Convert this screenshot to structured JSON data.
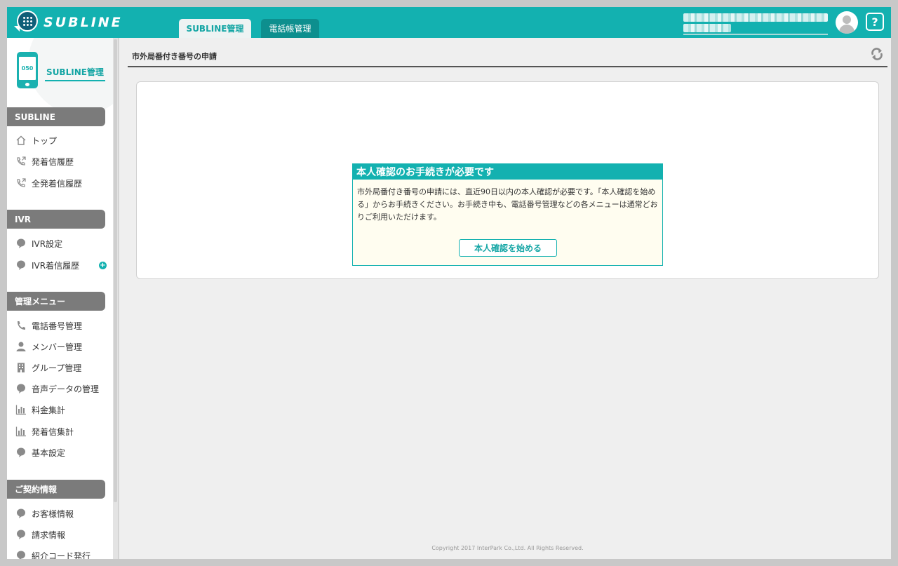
{
  "header": {
    "logo_text": "SUBLINE",
    "tabs": [
      {
        "label": "SUBLINE管理",
        "active": true
      },
      {
        "label": "電話帳管理",
        "active": false
      }
    ],
    "help_label": "?"
  },
  "sidebar": {
    "brand": {
      "phone_number_prefix": "050",
      "label": "SUBLINE管理"
    },
    "sections": [
      {
        "title": "SUBLINE",
        "items": [
          {
            "label": "トップ",
            "icon": "home-icon"
          },
          {
            "label": "発着信履歴",
            "icon": "phone-arrow-icon"
          },
          {
            "label": "全発着信履歴",
            "icon": "phone-arrow-icon"
          }
        ]
      },
      {
        "title": "IVR",
        "items": [
          {
            "label": "IVR設定",
            "icon": "bubble-icon"
          },
          {
            "label": "IVR着信履歴",
            "icon": "bubble-icon",
            "badge": "+"
          }
        ]
      },
      {
        "title": "管理メニュー",
        "items": [
          {
            "label": "電話番号管理",
            "icon": "phone-icon"
          },
          {
            "label": "メンバー管理",
            "icon": "person-icon"
          },
          {
            "label": "グループ管理",
            "icon": "building-icon"
          },
          {
            "label": "音声データの管理",
            "icon": "bubble-icon"
          },
          {
            "label": "料金集計",
            "icon": "bar-chart-icon"
          },
          {
            "label": "発着信集計",
            "icon": "bar-chart-icon"
          },
          {
            "label": "基本設定",
            "icon": "bubble-icon"
          }
        ]
      },
      {
        "title": "ご契約情報",
        "items": [
          {
            "label": "お客様情報",
            "icon": "bubble-icon"
          },
          {
            "label": "請求情報",
            "icon": "bubble-icon"
          },
          {
            "label": "紹介コード発行",
            "icon": "bubble-icon"
          }
        ]
      }
    ]
  },
  "main": {
    "page_title": "市外局番付き番号の申請",
    "notice": {
      "heading": "本人確認のお手続きが必要です",
      "body": "市外局番付き番号の申請には、直近90日以内の本人確認が必要です。「本人確認を始める」からお手続きください。お手続き中も、電話番号管理などの各メニューは通常どおりご利用いただけます。",
      "button_label": "本人確認を始める"
    },
    "copyright": "Copyright 2017 InterPark Co.,Ltd. All Rights Reserved."
  },
  "colors": {
    "brand": "#13b1b0",
    "section_header": "#7b7b7b"
  }
}
